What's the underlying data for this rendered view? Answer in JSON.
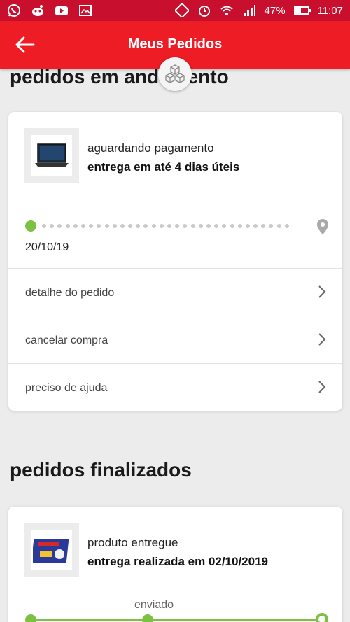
{
  "status_bar": {
    "battery_text": "47%",
    "battery_level": 0.47,
    "time": "11:07",
    "left_icons": [
      "whatsapp-icon",
      "reddit-icon",
      "youtube-icon",
      "gallery-icon"
    ],
    "right_icons": [
      "sync-icon",
      "alarm-icon",
      "wifi-icon",
      "signal-icon",
      "battery-icon"
    ]
  },
  "app_bar": {
    "title": "Meus Pedidos",
    "back_icon": "arrow-left-icon",
    "accent_color": "#ee1c25"
  },
  "section_in_progress": {
    "title": "pedidos em andamento",
    "order": {
      "status": "aguardando pagamento",
      "delivery": "entrega em até 4 dias úteis",
      "date": "20/10/19",
      "product_image": "laptop-image",
      "actions": [
        {
          "label": "detalhe do pedido"
        },
        {
          "label": "cancelar compra"
        },
        {
          "label": "preciso de ajuda"
        }
      ]
    }
  },
  "section_finished": {
    "title": "pedidos finalizados",
    "order": {
      "status": "produto entregue",
      "delivery": "entrega realizada em 02/10/2019",
      "tracking_label": "enviado",
      "product_image": "board-game-image"
    }
  },
  "colors": {
    "progress_green": "#7cc142",
    "status_bar": "#c8102e"
  }
}
